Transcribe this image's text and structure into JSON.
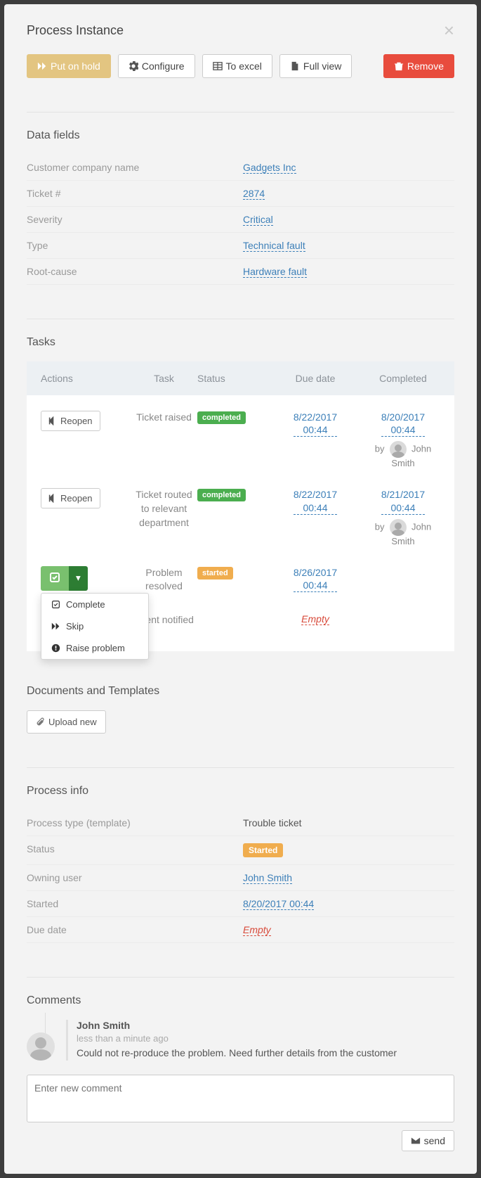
{
  "title": "Process Instance",
  "buttons": {
    "hold": "Put on hold",
    "configure": "Configure",
    "excel": "To excel",
    "full": "Full view",
    "remove": "Remove"
  },
  "sections": {
    "data": "Data fields",
    "tasks": "Tasks",
    "docs": "Documents and Templates",
    "info": "Process info",
    "comments": "Comments"
  },
  "data_fields": [
    {
      "label": "Customer company name",
      "value": "Gadgets Inc",
      "type": "link"
    },
    {
      "label": "Ticket #",
      "value": "2874",
      "type": "link"
    },
    {
      "label": "Severity",
      "value": "Critical",
      "type": "link"
    },
    {
      "label": "Type",
      "value": "Technical fault",
      "type": "link"
    },
    {
      "label": "Root-cause",
      "value": "Hardware fault",
      "type": "link"
    }
  ],
  "task_headers": {
    "a": "Actions",
    "t": "Task",
    "s": "Status",
    "d": "Due date",
    "c": "Completed"
  },
  "tasks": [
    {
      "action": "Reopen",
      "name": "Ticket raised",
      "status": "completed",
      "due": "8/22/2017 00:44",
      "completed": "8/20/2017 00:44",
      "by": "John Smith"
    },
    {
      "action": "Reopen",
      "name": "Ticket routed to relevant department",
      "status": "completed",
      "due": "8/22/2017 00:44",
      "completed": "8/21/2017 00:44",
      "by": "John Smith"
    },
    {
      "action": "split",
      "name": "Problem resolved",
      "status": "started",
      "due": "8/26/2017 00:44"
    },
    {
      "name": "Client notified",
      "empty": "Empty"
    }
  ],
  "dropdown": [
    "Complete",
    "Skip",
    "Raise problem"
  ],
  "upload": "Upload new",
  "info": [
    {
      "label": "Process type (template)",
      "value": "Trouble ticket",
      "type": "plain"
    },
    {
      "label": "Status",
      "value": "Started",
      "type": "badge"
    },
    {
      "label": "Owning user",
      "value": "John Smith",
      "type": "link"
    },
    {
      "label": "Started",
      "value": "8/20/2017 00:44",
      "type": "link"
    },
    {
      "label": "Due date",
      "value": "Empty",
      "type": "empty"
    }
  ],
  "comment": {
    "author": "John Smith",
    "time": "less than a minute ago",
    "text": "Could not re-produce the problem. Need further details from the customer"
  },
  "comment_placeholder": "Enter new comment",
  "send": "send",
  "by_label": "by"
}
